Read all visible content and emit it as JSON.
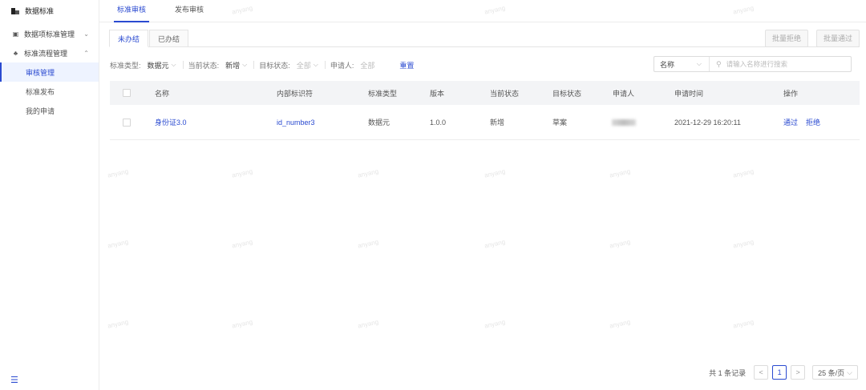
{
  "sidebar": {
    "brand": "数据标准",
    "groups": [
      {
        "label": "数据项标准管理",
        "icon": "database-icon",
        "expanded": false
      },
      {
        "label": "标准流程管理",
        "icon": "flow-icon",
        "expanded": true
      }
    ],
    "items": [
      {
        "label": "审核管理",
        "active": true
      },
      {
        "label": "标准发布",
        "active": false
      },
      {
        "label": "我的申请",
        "active": false
      }
    ]
  },
  "top_tabs": [
    {
      "label": "标准审核",
      "active": true
    },
    {
      "label": "发布审核",
      "active": false
    }
  ],
  "sub_tabs": [
    {
      "label": "未办结",
      "active": true
    },
    {
      "label": "已办结",
      "active": false
    }
  ],
  "batch": {
    "reject": "批量拒绝",
    "approve": "批量通过"
  },
  "filters": [
    {
      "label": "标准类型:",
      "value": "数据元",
      "muted": false
    },
    {
      "label": "当前状态:",
      "value": "新增",
      "muted": false
    },
    {
      "label": "目标状态:",
      "value": "全部",
      "muted": true
    },
    {
      "label": "申请人:",
      "value": "全部",
      "muted": true
    }
  ],
  "reset_label": "重置",
  "search": {
    "field": "名称",
    "placeholder": "请输入名称进行搜索"
  },
  "table": {
    "columns": [
      "名称",
      "内部标识符",
      "标准类型",
      "版本",
      "当前状态",
      "目标状态",
      "申请人",
      "申请时间",
      "操作"
    ],
    "rows": [
      {
        "name": "身份证3.0",
        "identifier": "id_number3",
        "type": "数据元",
        "version": "1.0.0",
        "current_status": "新增",
        "target_status": "草案",
        "applicant": "",
        "time": "2021-12-29 16:20:11",
        "actions": [
          "通过",
          "拒绝"
        ]
      }
    ]
  },
  "pagination": {
    "total": "共 1 条记录",
    "page": "1",
    "size": "25 条/页"
  },
  "watermark": "anyang",
  "colors": {
    "accent": "#2a4ad0"
  }
}
